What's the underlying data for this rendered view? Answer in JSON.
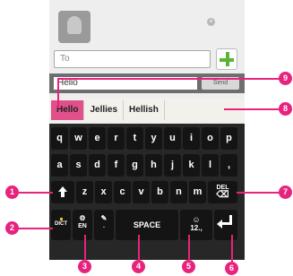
{
  "compose": {
    "to_placeholder": "To",
    "message_value": "Hello",
    "send_label": "Send",
    "dismiss_glyph": "×"
  },
  "suggestions": [
    "Hello",
    "Jellies",
    "Hellish"
  ],
  "keyboard": {
    "row1": [
      "q",
      "w",
      "e",
      "r",
      "t",
      "y",
      "u",
      "i",
      "o",
      "p"
    ],
    "row2": [
      "a",
      "s",
      "d",
      "f",
      "g",
      "h",
      "j",
      "k",
      "l",
      ","
    ],
    "row3": [
      "z",
      "x",
      "c",
      "v",
      "b",
      "n",
      "m"
    ],
    "del_label": "DEL",
    "dict_label": "DICT",
    "lang_label": "EN",
    "period_label": ".",
    "space_label": "SPACE",
    "num_label": "12.,",
    "emoji_glyph": "☺",
    "gear_glyph": "⚙",
    "pencil_glyph": "✎",
    "backspace_glyph": "⌫"
  },
  "callouts": [
    "1",
    "2",
    "3",
    "4",
    "5",
    "6",
    "7",
    "8",
    "9"
  ],
  "colors": {
    "accent": "#e8237d",
    "suggest_selected": "#e0508a",
    "add_green": "#5cb336"
  }
}
